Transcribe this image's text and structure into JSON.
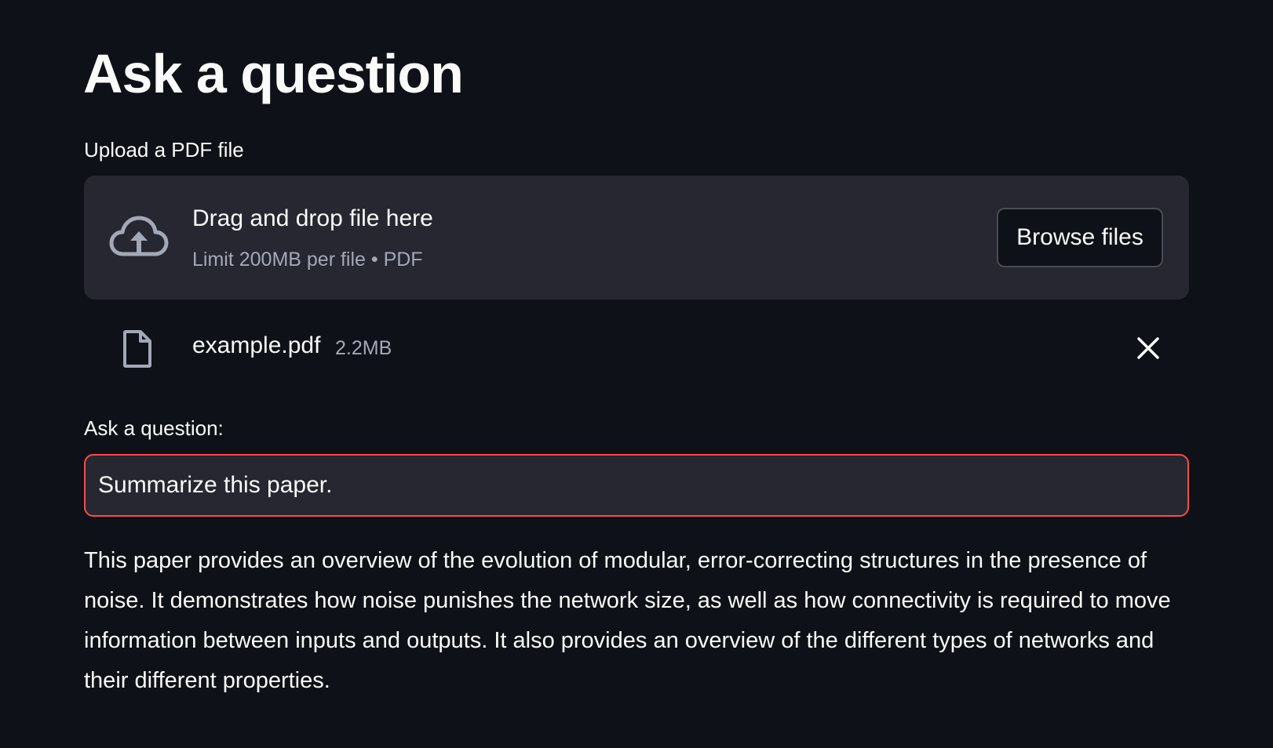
{
  "header": {
    "title": "Ask a question"
  },
  "uploader": {
    "label": "Upload a PDF file",
    "drop_text": "Drag and drop file here",
    "limit_text": "Limit 200MB per file • PDF",
    "browse_label": "Browse files",
    "icon": "cloud-upload-icon"
  },
  "file": {
    "name": "example.pdf",
    "size": "2.2MB",
    "icon": "file-icon",
    "remove_icon": "close-icon"
  },
  "question": {
    "label": "Ask a question:",
    "value": "Summarize this paper."
  },
  "answer": {
    "text": "This paper provides an overview of the evolution of modular, error-correcting structures in the presence of noise. It demonstrates how noise punishes the network size, as well as how connectivity is required to move information between inputs and outputs. It also provides an overview of the different types of networks and their different properties."
  },
  "colors": {
    "background": "#0e1117",
    "surface": "#262730",
    "accent": "#ff4b4b",
    "muted_text": "#a3a8b8"
  }
}
